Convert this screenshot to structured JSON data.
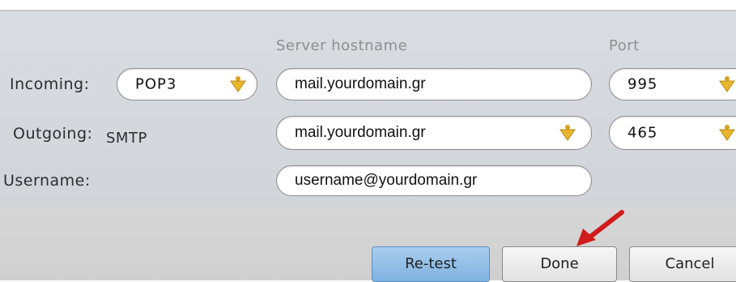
{
  "headers": {
    "server_hostname": "Server hostname",
    "port": "Port"
  },
  "incoming": {
    "label": "Incoming:",
    "protocol": "POP3",
    "hostname": "mail.yourdomain.gr",
    "port": "995"
  },
  "outgoing": {
    "label": "Outgoing:",
    "protocol": "SMTP",
    "hostname": "mail.yourdomain.gr",
    "port": "465"
  },
  "username": {
    "label": "Username:",
    "value": "username@yourdomain.gr"
  },
  "buttons": {
    "retest": "Re-test",
    "done": "Done",
    "cancel": "Cancel"
  },
  "icons": {
    "dropdown": "dropdown-arrow-icon",
    "annotation": "red-arrow-icon"
  },
  "colors": {
    "accent": "#e8b62c",
    "annotation_arrow": "#d01c1c",
    "retest_button": "#8fbfe8"
  }
}
